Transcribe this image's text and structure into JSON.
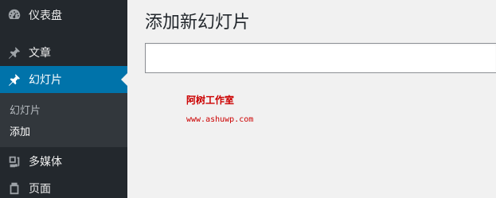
{
  "sidebar": {
    "items": [
      {
        "label": "仪表盘",
        "icon": "dashboard-icon"
      },
      {
        "label": "文章",
        "icon": "pin-icon"
      },
      {
        "label": "幻灯片",
        "icon": "pin-icon",
        "current": true
      },
      {
        "label": "多媒体",
        "icon": "media-icon"
      },
      {
        "label": "页面",
        "icon": "page-icon"
      }
    ],
    "submenu": {
      "items": [
        {
          "label": "幻灯片"
        },
        {
          "label": "添加",
          "current": true
        }
      ]
    }
  },
  "main": {
    "title": "添加新幻灯片",
    "title_input": {
      "value": "",
      "placeholder": ""
    }
  },
  "watermark": {
    "name": "阿树工作室",
    "url": "www.ashuwp.com"
  },
  "colors": {
    "sidebar_bg": "#23282d",
    "submenu_bg": "#32373c",
    "accent": "#0073aa",
    "content_bg": "#f1f1f1",
    "watermark": "#cc0000"
  }
}
